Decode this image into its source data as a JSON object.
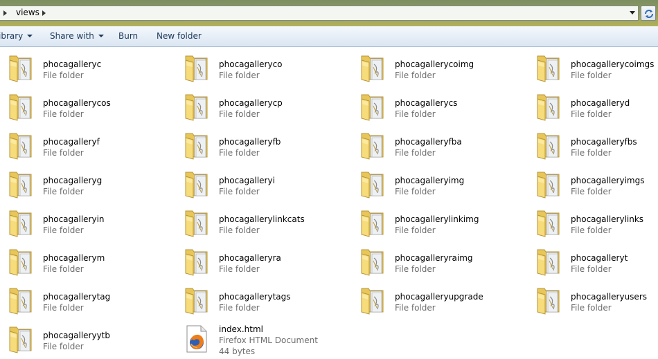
{
  "address": {
    "segment": "views"
  },
  "toolbar": {
    "library_label": "ibrary",
    "share_label": "Share with",
    "burn_label": "Burn",
    "new_folder_label": "New folder"
  },
  "folder_type": "File folder",
  "items": [
    {
      "name": "phocagalleryc",
      "type": "File folder"
    },
    {
      "name": "phocagalleryco",
      "type": "File folder"
    },
    {
      "name": "phocagallerycoimg",
      "type": "File folder"
    },
    {
      "name": "phocagallerycoimgs",
      "type": "File folder"
    },
    {
      "name": "phocagallerycos",
      "type": "File folder"
    },
    {
      "name": "phocagallerycp",
      "type": "File folder"
    },
    {
      "name": "phocagallerycs",
      "type": "File folder"
    },
    {
      "name": "phocagalleryd",
      "type": "File folder"
    },
    {
      "name": "phocagalleryf",
      "type": "File folder"
    },
    {
      "name": "phocagalleryfb",
      "type": "File folder"
    },
    {
      "name": "phocagalleryfba",
      "type": "File folder"
    },
    {
      "name": "phocagalleryfbs",
      "type": "File folder"
    },
    {
      "name": "phocagalleryg",
      "type": "File folder"
    },
    {
      "name": "phocagalleryi",
      "type": "File folder"
    },
    {
      "name": "phocagalleryimg",
      "type": "File folder"
    },
    {
      "name": "phocagalleryimgs",
      "type": "File folder"
    },
    {
      "name": "phocagalleryin",
      "type": "File folder"
    },
    {
      "name": "phocagallerylinkcats",
      "type": "File folder"
    },
    {
      "name": "phocagallerylinkimg",
      "type": "File folder"
    },
    {
      "name": "phocagallerylinks",
      "type": "File folder"
    },
    {
      "name": "phocagallerym",
      "type": "File folder"
    },
    {
      "name": "phocagalleryra",
      "type": "File folder"
    },
    {
      "name": "phocagalleryraimg",
      "type": "File folder"
    },
    {
      "name": "phocagalleryt",
      "type": "File folder"
    },
    {
      "name": "phocagallerytag",
      "type": "File folder"
    },
    {
      "name": "phocagallerytags",
      "type": "File folder"
    },
    {
      "name": "phocagalleryupgrade",
      "type": "File folder"
    },
    {
      "name": "phocagalleryusers",
      "type": "File folder"
    },
    {
      "name": "phocagalleryytb",
      "type": "File folder"
    }
  ],
  "file": {
    "name": "index.html",
    "type": "Firefox HTML Document",
    "size": "44 bytes"
  },
  "colors": {
    "toolbar_text": "#1e395b",
    "secondary_text": "#6d6d6d",
    "folder": "#f2d46a"
  },
  "icons": {
    "folder": "folder-icon",
    "file": "firefox-document-icon",
    "refresh": "refresh-icon"
  }
}
